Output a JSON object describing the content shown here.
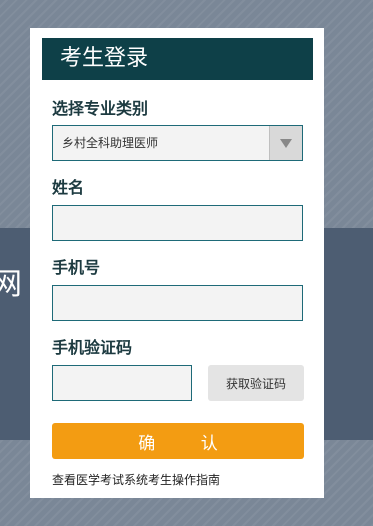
{
  "background": {
    "partial_char": "网"
  },
  "login": {
    "title": "考生登录",
    "category": {
      "label": "选择专业类别",
      "selected": "乡村全科助理医师"
    },
    "name": {
      "label": "姓名",
      "value": "",
      "placeholder": ""
    },
    "phone": {
      "label": "手机号",
      "value": "",
      "placeholder": ""
    },
    "code": {
      "label": "手机验证码",
      "value": "",
      "placeholder": "",
      "button_label": "获取验证码"
    },
    "confirm_label": "确 认",
    "guide_link": "查看医学考试系统考生操作指南"
  },
  "colors": {
    "header_bg": "#0e4048",
    "field_border": "#1e6a78",
    "confirm_bg": "#f39c12",
    "page_bg": "#7a8797",
    "band_bg": "#4d5d72"
  },
  "icons": {
    "select_arrow": "caret-down-icon"
  }
}
